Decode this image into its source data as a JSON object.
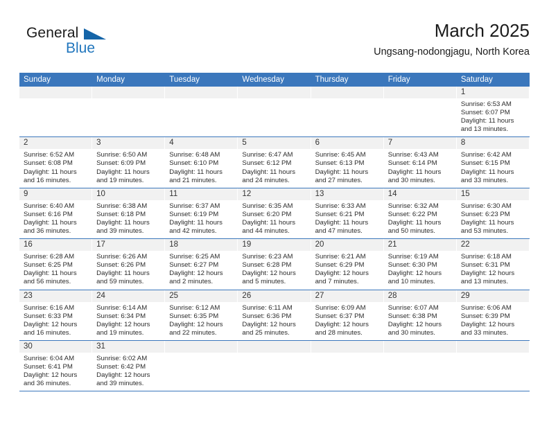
{
  "brand": {
    "name_part1": "General",
    "name_part2": "Blue",
    "flag_icon": "triangle-flag-icon",
    "accent_color": "#2176bd"
  },
  "header": {
    "title": "March 2025",
    "subtitle": "Ungsang-nodongjagu, North Korea"
  },
  "theme": {
    "header_row_bg": "#3b77bc",
    "day_number_bg": "#f1f1f1",
    "row_separator": "#3b77bc",
    "text_color": "#2b2b2b"
  },
  "weekdays": [
    "Sunday",
    "Monday",
    "Tuesday",
    "Wednesday",
    "Thursday",
    "Friday",
    "Saturday"
  ],
  "labels": {
    "sunrise_prefix": "Sunrise:",
    "sunset_prefix": "Sunset:",
    "daylight_prefix": "Daylight:"
  },
  "calendar_data": {
    "month": "March",
    "year": 2025,
    "location": "Ungsang-nodongjagu, North Korea",
    "weeks": [
      [
        {
          "day": ""
        },
        {
          "day": ""
        },
        {
          "day": ""
        },
        {
          "day": ""
        },
        {
          "day": ""
        },
        {
          "day": ""
        },
        {
          "day": "1",
          "sunrise": "Sunrise: 6:53 AM",
          "sunset": "Sunset: 6:07 PM",
          "daylight": "Daylight: 11 hours and 13 minutes."
        }
      ],
      [
        {
          "day": "2",
          "sunrise": "Sunrise: 6:52 AM",
          "sunset": "Sunset: 6:08 PM",
          "daylight": "Daylight: 11 hours and 16 minutes."
        },
        {
          "day": "3",
          "sunrise": "Sunrise: 6:50 AM",
          "sunset": "Sunset: 6:09 PM",
          "daylight": "Daylight: 11 hours and 19 minutes."
        },
        {
          "day": "4",
          "sunrise": "Sunrise: 6:48 AM",
          "sunset": "Sunset: 6:10 PM",
          "daylight": "Daylight: 11 hours and 21 minutes."
        },
        {
          "day": "5",
          "sunrise": "Sunrise: 6:47 AM",
          "sunset": "Sunset: 6:12 PM",
          "daylight": "Daylight: 11 hours and 24 minutes."
        },
        {
          "day": "6",
          "sunrise": "Sunrise: 6:45 AM",
          "sunset": "Sunset: 6:13 PM",
          "daylight": "Daylight: 11 hours and 27 minutes."
        },
        {
          "day": "7",
          "sunrise": "Sunrise: 6:43 AM",
          "sunset": "Sunset: 6:14 PM",
          "daylight": "Daylight: 11 hours and 30 minutes."
        },
        {
          "day": "8",
          "sunrise": "Sunrise: 6:42 AM",
          "sunset": "Sunset: 6:15 PM",
          "daylight": "Daylight: 11 hours and 33 minutes."
        }
      ],
      [
        {
          "day": "9",
          "sunrise": "Sunrise: 6:40 AM",
          "sunset": "Sunset: 6:16 PM",
          "daylight": "Daylight: 11 hours and 36 minutes."
        },
        {
          "day": "10",
          "sunrise": "Sunrise: 6:38 AM",
          "sunset": "Sunset: 6:18 PM",
          "daylight": "Daylight: 11 hours and 39 minutes."
        },
        {
          "day": "11",
          "sunrise": "Sunrise: 6:37 AM",
          "sunset": "Sunset: 6:19 PM",
          "daylight": "Daylight: 11 hours and 42 minutes."
        },
        {
          "day": "12",
          "sunrise": "Sunrise: 6:35 AM",
          "sunset": "Sunset: 6:20 PM",
          "daylight": "Daylight: 11 hours and 44 minutes."
        },
        {
          "day": "13",
          "sunrise": "Sunrise: 6:33 AM",
          "sunset": "Sunset: 6:21 PM",
          "daylight": "Daylight: 11 hours and 47 minutes."
        },
        {
          "day": "14",
          "sunrise": "Sunrise: 6:32 AM",
          "sunset": "Sunset: 6:22 PM",
          "daylight": "Daylight: 11 hours and 50 minutes."
        },
        {
          "day": "15",
          "sunrise": "Sunrise: 6:30 AM",
          "sunset": "Sunset: 6:23 PM",
          "daylight": "Daylight: 11 hours and 53 minutes."
        }
      ],
      [
        {
          "day": "16",
          "sunrise": "Sunrise: 6:28 AM",
          "sunset": "Sunset: 6:25 PM",
          "daylight": "Daylight: 11 hours and 56 minutes."
        },
        {
          "day": "17",
          "sunrise": "Sunrise: 6:26 AM",
          "sunset": "Sunset: 6:26 PM",
          "daylight": "Daylight: 11 hours and 59 minutes."
        },
        {
          "day": "18",
          "sunrise": "Sunrise: 6:25 AM",
          "sunset": "Sunset: 6:27 PM",
          "daylight": "Daylight: 12 hours and 2 minutes."
        },
        {
          "day": "19",
          "sunrise": "Sunrise: 6:23 AM",
          "sunset": "Sunset: 6:28 PM",
          "daylight": "Daylight: 12 hours and 5 minutes."
        },
        {
          "day": "20",
          "sunrise": "Sunrise: 6:21 AM",
          "sunset": "Sunset: 6:29 PM",
          "daylight": "Daylight: 12 hours and 7 minutes."
        },
        {
          "day": "21",
          "sunrise": "Sunrise: 6:19 AM",
          "sunset": "Sunset: 6:30 PM",
          "daylight": "Daylight: 12 hours and 10 minutes."
        },
        {
          "day": "22",
          "sunrise": "Sunrise: 6:18 AM",
          "sunset": "Sunset: 6:31 PM",
          "daylight": "Daylight: 12 hours and 13 minutes."
        }
      ],
      [
        {
          "day": "23",
          "sunrise": "Sunrise: 6:16 AM",
          "sunset": "Sunset: 6:33 PM",
          "daylight": "Daylight: 12 hours and 16 minutes."
        },
        {
          "day": "24",
          "sunrise": "Sunrise: 6:14 AM",
          "sunset": "Sunset: 6:34 PM",
          "daylight": "Daylight: 12 hours and 19 minutes."
        },
        {
          "day": "25",
          "sunrise": "Sunrise: 6:12 AM",
          "sunset": "Sunset: 6:35 PM",
          "daylight": "Daylight: 12 hours and 22 minutes."
        },
        {
          "day": "26",
          "sunrise": "Sunrise: 6:11 AM",
          "sunset": "Sunset: 6:36 PM",
          "daylight": "Daylight: 12 hours and 25 minutes."
        },
        {
          "day": "27",
          "sunrise": "Sunrise: 6:09 AM",
          "sunset": "Sunset: 6:37 PM",
          "daylight": "Daylight: 12 hours and 28 minutes."
        },
        {
          "day": "28",
          "sunrise": "Sunrise: 6:07 AM",
          "sunset": "Sunset: 6:38 PM",
          "daylight": "Daylight: 12 hours and 30 minutes."
        },
        {
          "day": "29",
          "sunrise": "Sunrise: 6:06 AM",
          "sunset": "Sunset: 6:39 PM",
          "daylight": "Daylight: 12 hours and 33 minutes."
        }
      ],
      [
        {
          "day": "30",
          "sunrise": "Sunrise: 6:04 AM",
          "sunset": "Sunset: 6:41 PM",
          "daylight": "Daylight: 12 hours and 36 minutes."
        },
        {
          "day": "31",
          "sunrise": "Sunrise: 6:02 AM",
          "sunset": "Sunset: 6:42 PM",
          "daylight": "Daylight: 12 hours and 39 minutes."
        },
        {
          "day": ""
        },
        {
          "day": ""
        },
        {
          "day": ""
        },
        {
          "day": ""
        },
        {
          "day": ""
        }
      ]
    ]
  }
}
